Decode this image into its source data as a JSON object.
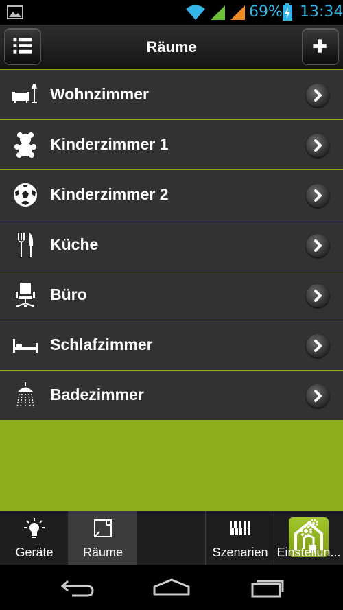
{
  "status_bar": {
    "battery_percent": "69%",
    "time": "13:34",
    "icons": [
      "image-icon",
      "wifi-icon",
      "signal-icon",
      "signal-roaming-icon",
      "battery-charging-icon"
    ],
    "accent_color": "#33b5e5"
  },
  "action_bar": {
    "title": "Räume",
    "left_button_icon": "list-menu-icon",
    "right_button_icon": "plus-icon"
  },
  "rooms": [
    {
      "label": "Wohnzimmer",
      "icon": "sofa-lamp-icon"
    },
    {
      "label": "Kinderzimmer 1",
      "icon": "teddy-bear-icon"
    },
    {
      "label": "Kinderzimmer 2",
      "icon": "soccer-ball-icon"
    },
    {
      "label": "Küche",
      "icon": "fork-knife-icon"
    },
    {
      "label": "Büro",
      "icon": "office-chair-icon"
    },
    {
      "label": "Schlafzimmer",
      "icon": "bed-icon"
    },
    {
      "label": "Badezimmer",
      "icon": "shower-icon"
    }
  ],
  "tabs": [
    {
      "label": "Geräte",
      "icon": "light-bulb-icon"
    },
    {
      "label": "Räume",
      "icon": "room-icon",
      "active": true
    },
    {
      "label": "",
      "icon": "home-plug-icon"
    },
    {
      "label": "Szenarien",
      "icon": "scenes-keyboard-icon"
    },
    {
      "label": "Einstellun...",
      "icon": "gears-icon"
    }
  ],
  "colors": {
    "accent_green": "#8fae1b",
    "row_background": "#323232",
    "tab_active": "#3c3c3c"
  }
}
